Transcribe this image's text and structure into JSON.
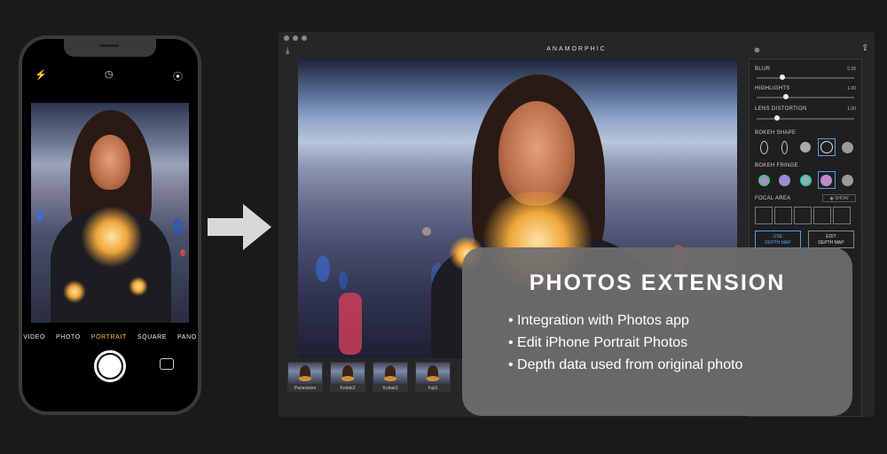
{
  "phone": {
    "modes": [
      "VIDEO",
      "PHOTO",
      "PORTRAIT",
      "SQUARE",
      "PANO"
    ],
    "active_mode": "PORTRAIT"
  },
  "app": {
    "title": "ANAMORPHIC",
    "panel": {
      "blur": {
        "label": "BLUR",
        "value": "0.26"
      },
      "highlights": {
        "label": "HIGHLIGHTS",
        "value": "1.00"
      },
      "lens_distortion": {
        "label": "LENS DISTORTION",
        "value": "1.00"
      },
      "bokeh_shape_label": "BOKEH SHAPE",
      "bokeh_fringe_label": "BOKEH FRINGE",
      "focal_area_label": "FOCAL AREA",
      "show_label": "SHOW",
      "use_depth_map_line1": "USE",
      "use_depth_map_line2": "DEPTH MAP",
      "edit_depth_map_line1": "EDIT",
      "edit_depth_map_line2": "DEPTH MAP"
    },
    "presets": [
      "Panavision",
      "Kodak2",
      "Kodak3",
      "Fuji1"
    ],
    "accent_color": "#5a9be0"
  },
  "card": {
    "title": "PHOTOS EXTENSION",
    "items": [
      "Integration with Photos app",
      "Edit iPhone Portrait Photos",
      "Depth data used from original photo"
    ]
  }
}
